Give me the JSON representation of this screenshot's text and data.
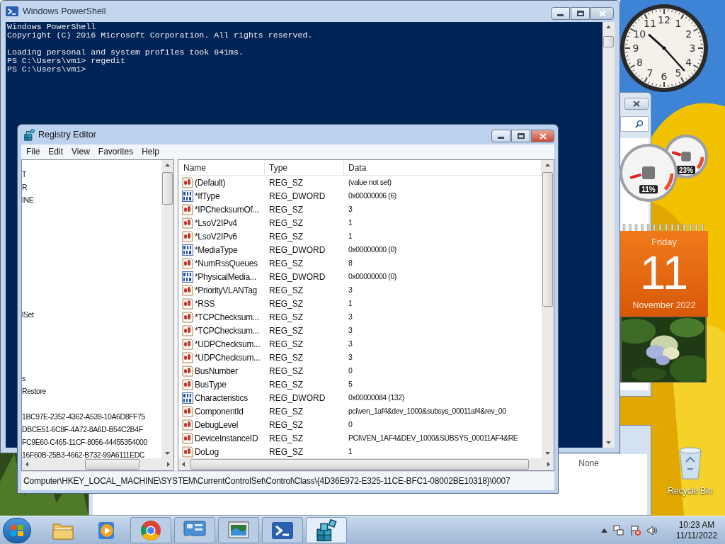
{
  "powershell": {
    "title": "Windows PowerShell",
    "blocks": [
      [
        "Windows PowerShell",
        "Copyright (C) 2016 Microsoft Corporation. All rights reserved."
      ],
      [
        "Loading personal and system profiles took 841ms.",
        "PS C:\\Users\\vm1> regedit",
        "PS C:\\Users\\vm1>"
      ]
    ]
  },
  "registry_editor": {
    "title": "Registry Editor",
    "menu": [
      "File",
      "Edit",
      "View",
      "Favorites",
      "Help"
    ],
    "tree": [
      "T",
      "R",
      "INE",
      "lSet",
      "s",
      "Restore",
      "1BC97E-2352-4362-A539-10A6D8FF75",
      "DBCE51-6C8F-4A72-8A6D-B54C2B4F",
      "FC9E60-C465-11CF-8056-44455354000",
      "16F60B-25B3-4662-B732-99A6111EDC"
    ],
    "columns": [
      "Name",
      "Type",
      "Data"
    ],
    "rows": [
      {
        "kind": "sz",
        "name": "(Default)",
        "type": "REG_SZ",
        "data": "(value not set)"
      },
      {
        "kind": "dword",
        "name": "*IfType",
        "type": "REG_DWORD",
        "data": "0x00000006 (6)"
      },
      {
        "kind": "sz",
        "name": "*IPChecksumOf...",
        "type": "REG_SZ",
        "data": "3"
      },
      {
        "kind": "sz",
        "name": "*LsoV2IPv4",
        "type": "REG_SZ",
        "data": "1"
      },
      {
        "kind": "sz",
        "name": "*LsoV2IPv6",
        "type": "REG_SZ",
        "data": "1"
      },
      {
        "kind": "dword",
        "name": "*MediaType",
        "type": "REG_DWORD",
        "data": "0x00000000 (0)"
      },
      {
        "kind": "sz",
        "name": "*NumRssQueues",
        "type": "REG_SZ",
        "data": "8"
      },
      {
        "kind": "dword",
        "name": "*PhysicalMedia...",
        "type": "REG_DWORD",
        "data": "0x00000000 (0)"
      },
      {
        "kind": "sz",
        "name": "*PriorityVLANTag",
        "type": "REG_SZ",
        "data": "3"
      },
      {
        "kind": "sz",
        "name": "*RSS",
        "type": "REG_SZ",
        "data": "1"
      },
      {
        "kind": "sz",
        "name": "*TCPChecksum...",
        "type": "REG_SZ",
        "data": "3"
      },
      {
        "kind": "sz",
        "name": "*TCPChecksum...",
        "type": "REG_SZ",
        "data": "3"
      },
      {
        "kind": "sz",
        "name": "*UDPChecksum...",
        "type": "REG_SZ",
        "data": "3"
      },
      {
        "kind": "sz",
        "name": "*UDPChecksum...",
        "type": "REG_SZ",
        "data": "3"
      },
      {
        "kind": "sz",
        "name": "BusNumber",
        "type": "REG_SZ",
        "data": "0"
      },
      {
        "kind": "sz",
        "name": "BusType",
        "type": "REG_SZ",
        "data": "5"
      },
      {
        "kind": "dword",
        "name": "Characteristics",
        "type": "REG_DWORD",
        "data": "0x00000084 (132)"
      },
      {
        "kind": "sz",
        "name": "ComponentId",
        "type": "REG_SZ",
        "data": "pci\\ven_1af4&dev_1000&subsys_00011af4&rev_00"
      },
      {
        "kind": "sz",
        "name": "DebugLevel",
        "type": "REG_SZ",
        "data": "0"
      },
      {
        "kind": "sz",
        "name": "DeviceInstanceID",
        "type": "REG_SZ",
        "data": "PCI\\VEN_1AF4&DEV_1000&SUBSYS_00011AF4&RE"
      },
      {
        "kind": "sz",
        "name": "DoLog",
        "type": "REG_SZ",
        "data": "1"
      }
    ],
    "status_bar": "Computer\\HKEY_LOCAL_MACHINE\\SYSTEM\\CurrentControlSet\\Control\\Class\\{4D36E972-E325-11CE-BFC1-08002BE10318}\\0007"
  },
  "background_window": {
    "text": "None"
  },
  "gadgets": {
    "clock": {
      "numerals": [
        "11",
        "12",
        "1",
        "10",
        "2",
        "9",
        "3",
        "8",
        "4",
        "7",
        "5",
        "6"
      ]
    },
    "meters": [
      {
        "reading": "11%"
      },
      {
        "reading": "23%"
      }
    ],
    "calendar": {
      "weekday": "Friday",
      "day": "11",
      "month_year": "November 2022"
    }
  },
  "desktop_icons": [
    {
      "label": "Recycle Bin"
    }
  ],
  "taskbar": {
    "items": [
      {
        "kind": "folder",
        "running": false,
        "selected": false
      },
      {
        "kind": "media",
        "running": false,
        "selected": false
      },
      {
        "kind": "browser",
        "running": true,
        "selected": false
      },
      {
        "kind": "control",
        "running": true,
        "selected": false
      },
      {
        "kind": "screen",
        "running": true,
        "selected": false
      },
      {
        "kind": "powershell",
        "running": true,
        "selected": false
      },
      {
        "kind": "regedit",
        "running": true,
        "selected": true
      }
    ],
    "time": "10:23 AM",
    "date": "11/11/2022"
  }
}
